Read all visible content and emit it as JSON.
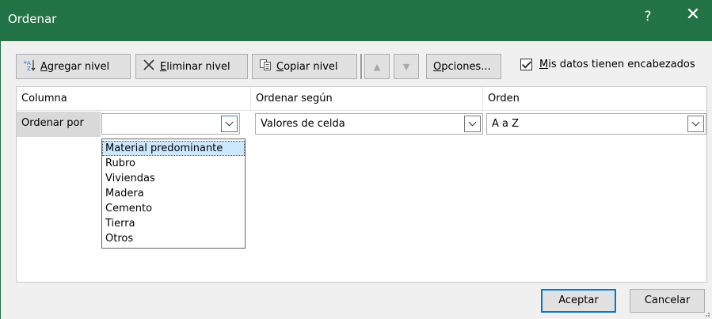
{
  "window": {
    "title": "Ordenar",
    "help_label": "?",
    "close_label": "✕"
  },
  "toolbar": {
    "add_level": {
      "prefix": "",
      "accel": "A",
      "rest": "gregar nivel"
    },
    "delete_level": {
      "accel": "E",
      "rest": "liminar nivel"
    },
    "copy_level": {
      "accel": "C",
      "rest": "opiar nivel"
    },
    "move_up_label": "▲",
    "move_down_label": "▼",
    "options": {
      "accel": "O",
      "rest": "pciones..."
    },
    "has_headers": {
      "accel": "M",
      "rest": "is datos tienen encabezados",
      "checked": true
    }
  },
  "grid": {
    "headers": {
      "column": "Columna",
      "sort_on": "Ordenar según",
      "order": "Orden"
    },
    "row": {
      "label": "Ordenar por",
      "column_value": "",
      "sort_on_value": "Valores de celda",
      "order_value": "A a Z"
    },
    "dropdown_options": [
      "Material predominante",
      "Rubro",
      "Viviendas",
      "Madera",
      "Cemento",
      "Tierra",
      "Otros"
    ],
    "dropdown_selected_index": 0
  },
  "footer": {
    "ok_label": "Aceptar",
    "cancel_label": "Cancelar"
  },
  "colors": {
    "titlebar": "#227447",
    "accent_blue": "#0078d7",
    "selection": "#cce8ff"
  }
}
